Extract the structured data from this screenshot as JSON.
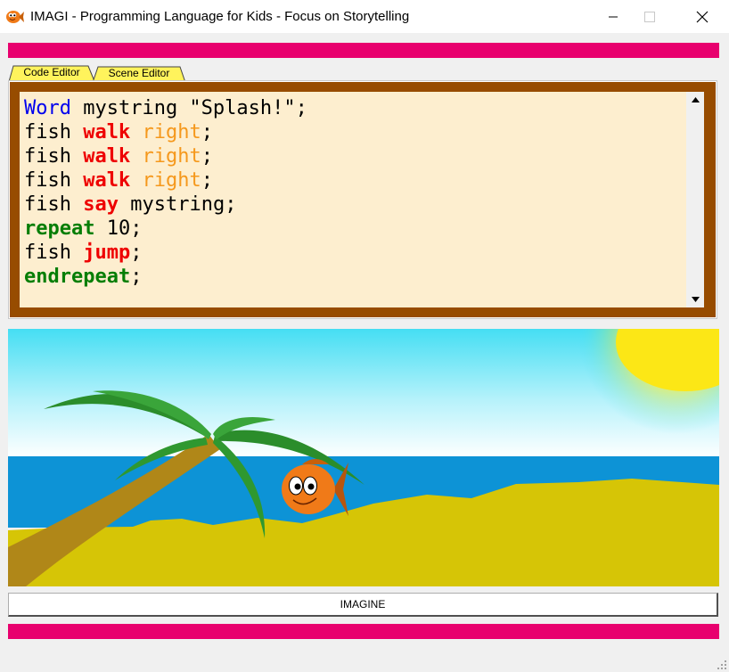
{
  "window": {
    "title": "IMAGI - Programming Language for Kids - Focus on Storytelling",
    "icon": "fish-app-icon"
  },
  "tabs": [
    {
      "label": "Code Editor",
      "active": true
    },
    {
      "label": "Scene Editor",
      "active": false
    }
  ],
  "code_lines": [
    [
      {
        "text": "Word",
        "style": "kw-blue"
      },
      {
        "text": " mystring \"Splash!\";",
        "style": ""
      }
    ],
    [
      {
        "text": "fish ",
        "style": ""
      },
      {
        "text": "walk",
        "style": "kw-red"
      },
      {
        "text": " ",
        "style": ""
      },
      {
        "text": "right",
        "style": "kw-orange"
      },
      {
        "text": ";",
        "style": ""
      }
    ],
    [
      {
        "text": "fish ",
        "style": ""
      },
      {
        "text": "walk",
        "style": "kw-red"
      },
      {
        "text": " ",
        "style": ""
      },
      {
        "text": "right",
        "style": "kw-orange"
      },
      {
        "text": ";",
        "style": ""
      }
    ],
    [
      {
        "text": "fish ",
        "style": ""
      },
      {
        "text": "walk",
        "style": "kw-red"
      },
      {
        "text": " ",
        "style": ""
      },
      {
        "text": "right",
        "style": "kw-orange"
      },
      {
        "text": ";",
        "style": ""
      }
    ],
    [
      {
        "text": "fish ",
        "style": ""
      },
      {
        "text": "say",
        "style": "kw-red"
      },
      {
        "text": " mystring;",
        "style": ""
      }
    ],
    [
      {
        "text": "repeat",
        "style": "kw-green"
      },
      {
        "text": " 10;",
        "style": ""
      }
    ],
    [
      {
        "text": "fish ",
        "style": ""
      },
      {
        "text": "jump",
        "style": "kw-red"
      },
      {
        "text": ";",
        "style": ""
      }
    ],
    [
      {
        "text": "endrepeat",
        "style": "kw-green"
      },
      {
        "text": ";",
        "style": ""
      }
    ]
  ],
  "scene": {
    "elements": [
      "sky",
      "sun",
      "sea",
      "beach",
      "palm-tree",
      "fish-character"
    ]
  },
  "run_button": {
    "label": "IMAGINE"
  },
  "colors": {
    "accent_bar": "#e8006e",
    "editor_frame": "#974c00",
    "editor_bg": "#fdeecf",
    "active_tab": "#fff35c",
    "keyword_blue": "#0000ee",
    "keyword_red": "#ee0000",
    "keyword_orange": "#f5981c",
    "keyword_green": "#067e06"
  }
}
